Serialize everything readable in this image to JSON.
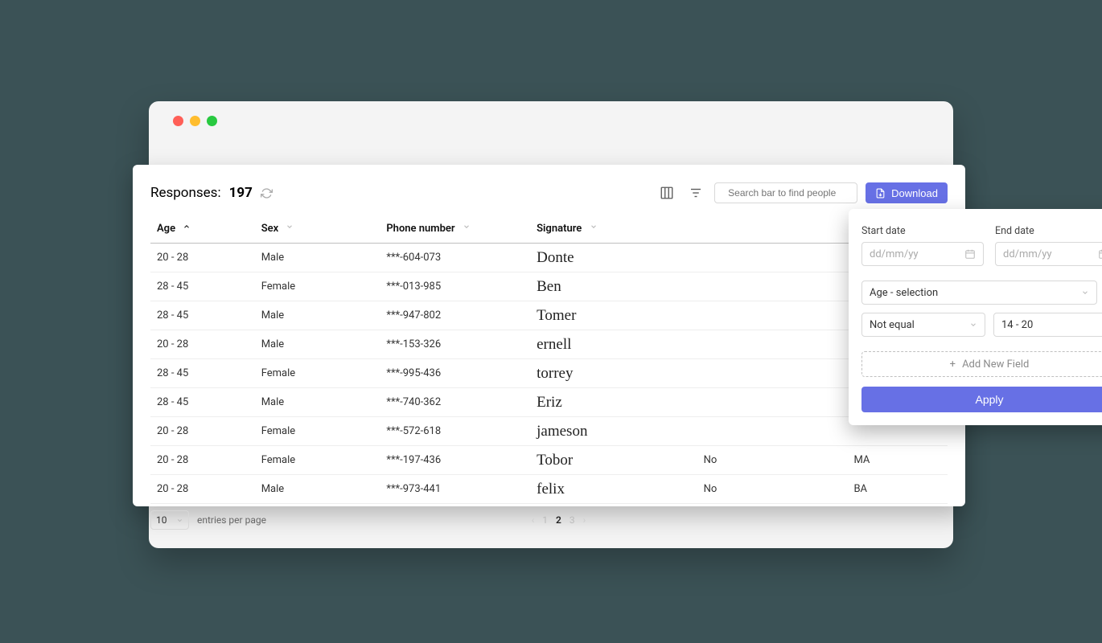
{
  "header": {
    "responses_label": "Responses:",
    "responses_count": "197"
  },
  "toolbar": {
    "search_placeholder": "Search bar to find people",
    "download_label": "Download"
  },
  "columns": {
    "age": "Age",
    "sex": "Sex",
    "phone": "Phone number",
    "signature": "Signature",
    "col5": "",
    "col6": ""
  },
  "rows": [
    {
      "age": "20 - 28",
      "sex": "Male",
      "phone": "***-604-073",
      "sig": "Donte",
      "c5": "",
      "c6": ""
    },
    {
      "age": "28 - 45",
      "sex": "Female",
      "phone": "***-013-985",
      "sig": "Ben",
      "c5": "",
      "c6": ""
    },
    {
      "age": "28 - 45",
      "sex": "Male",
      "phone": "***-947-802",
      "sig": "Tomer",
      "c5": "",
      "c6": ""
    },
    {
      "age": "20 - 28",
      "sex": "Male",
      "phone": "***-153-326",
      "sig": "ernell",
      "c5": "",
      "c6": ""
    },
    {
      "age": "28 - 45",
      "sex": "Female",
      "phone": "***-995-436",
      "sig": "torrey",
      "c5": "",
      "c6": ""
    },
    {
      "age": "28 - 45",
      "sex": "Male",
      "phone": "***-740-362",
      "sig": "Eriz",
      "c5": "",
      "c6": ""
    },
    {
      "age": "20 - 28",
      "sex": "Female",
      "phone": "***-572-618",
      "sig": "jameson",
      "c5": "",
      "c6": ""
    },
    {
      "age": "20 - 28",
      "sex": "Female",
      "phone": "***-197-436",
      "sig": "Tobor",
      "c5": "No",
      "c6": "MA"
    },
    {
      "age": "20 - 28",
      "sex": "Male",
      "phone": "***-973-441",
      "sig": "felix",
      "c5": "No",
      "c6": "BA"
    }
  ],
  "pagination": {
    "per_page": "10",
    "per_page_label": "entries per page",
    "pages": [
      "1",
      "2",
      "3"
    ],
    "active_page": "2"
  },
  "filter_panel": {
    "start_date_label": "Start date",
    "end_date_label": "End date",
    "date_placeholder": "dd/mm/yy",
    "field_selector": "Age - selection",
    "condition": "Not equal",
    "value": "14 - 20",
    "add_field_label": "Add New Field",
    "apply_label": "Apply"
  }
}
